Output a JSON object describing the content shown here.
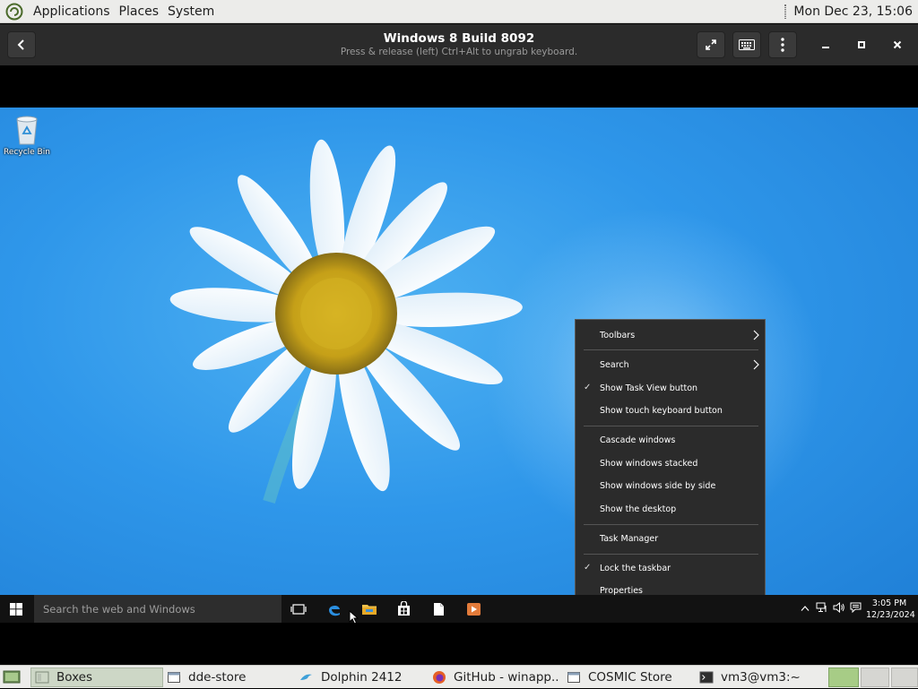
{
  "top_panel": {
    "menus": [
      "Applications",
      "Places",
      "System"
    ],
    "clock": "Mon Dec 23, 15:06"
  },
  "boxes": {
    "title": "Windows 8 Build 8092",
    "subtitle": "Press & release (left) Ctrl+Alt to ungrab keyboard."
  },
  "guest": {
    "desktop_icons": [
      {
        "label": "Recycle Bin",
        "icon": "recycle-bin-icon"
      }
    ],
    "taskbar": {
      "search_placeholder": "Search the web and Windows",
      "pinned": [
        "task-view-icon",
        "edge-icon",
        "file-explorer-icon",
        "store-icon",
        "document-icon",
        "media-player-icon"
      ],
      "tray_icons": [
        "chevron-up-icon",
        "network-icon",
        "volume-icon",
        "action-center-icon"
      ],
      "time": "3:05 PM",
      "date": "12/23/2024"
    },
    "context_menu": {
      "items": [
        {
          "label": "Toolbars",
          "submenu": true,
          "checked": false
        },
        {
          "label": "Search",
          "submenu": true,
          "checked": false
        },
        {
          "label": "Show Task View button",
          "submenu": false,
          "checked": true
        },
        {
          "label": "Show touch keyboard button",
          "submenu": false,
          "checked": false
        },
        {
          "label": "Cascade windows",
          "submenu": false,
          "checked": false
        },
        {
          "label": "Show windows stacked",
          "submenu": false,
          "checked": false
        },
        {
          "label": "Show windows side by side",
          "submenu": false,
          "checked": false
        },
        {
          "label": "Show the desktop",
          "submenu": false,
          "checked": false
        },
        {
          "label": "Task Manager",
          "submenu": false,
          "checked": false
        },
        {
          "label": "Lock the taskbar",
          "submenu": false,
          "checked": true
        },
        {
          "label": "Properties",
          "submenu": false,
          "checked": false
        }
      ]
    }
  },
  "bottom_panel": {
    "tasks": [
      {
        "label": "Boxes",
        "active": true
      },
      {
        "label": "dde-store",
        "active": false
      },
      {
        "label": "Dolphin 2412",
        "active": false
      },
      {
        "label": "GitHub - winapp...",
        "active": false
      },
      {
        "label": "COSMIC Store",
        "active": false
      },
      {
        "label": "vm3@vm3:~",
        "active": false
      }
    ],
    "workspaces": 3,
    "active_workspace": 1
  },
  "colors": {
    "panel_bg": "#ececea",
    "boxes_header_bg": "#2b2b2b",
    "desktop_blue": "#2f97ea",
    "taskbar_bg": "#121212",
    "menu_bg": "#2b2b2b",
    "workspace_active": "#a7cc86"
  }
}
